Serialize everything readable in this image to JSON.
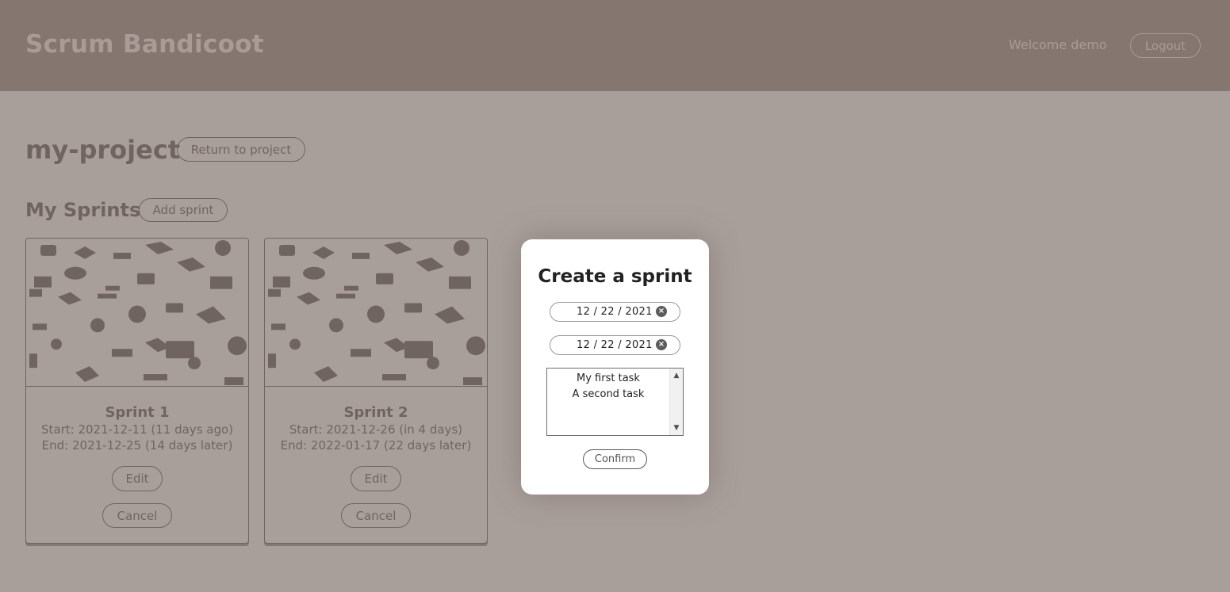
{
  "header": {
    "brand": "Scrum Bandicoot",
    "welcome": "Welcome demo",
    "logout_label": "Logout"
  },
  "project": {
    "name": "my-project",
    "return_label": "Return to project"
  },
  "sprints_section": {
    "title": "My Sprints",
    "add_label": "Add sprint"
  },
  "sprints": [
    {
      "name": "Sprint 1",
      "start": "Start: 2021-12-11 (11 days ago)",
      "end": "End: 2021-12-25 (14 days later)",
      "edit_label": "Edit",
      "cancel_label": "Cancel"
    },
    {
      "name": "Sprint 2",
      "start": "Start: 2021-12-26 (in 4 days)",
      "end": "End: 2022-01-17 (22 days later)",
      "edit_label": "Edit",
      "cancel_label": "Cancel"
    }
  ],
  "modal": {
    "title": "Create a sprint",
    "start_date": "12 / 22 / 2021",
    "end_date": "12 / 22 / 2021",
    "tasks": [
      "My first task",
      "A second task"
    ],
    "confirm_label": "Confirm"
  },
  "colors": {
    "header_bg": "#85766f",
    "page_bg": "#a89f9b",
    "text": "#6f6460",
    "modal_bg": "#ffffff"
  },
  "icons": {
    "card_art": "isometric-office-icons-pattern",
    "date_clear": "clear-circle-x-icon",
    "scroll_up": "chevron-up-icon",
    "scroll_down": "chevron-down-icon"
  }
}
